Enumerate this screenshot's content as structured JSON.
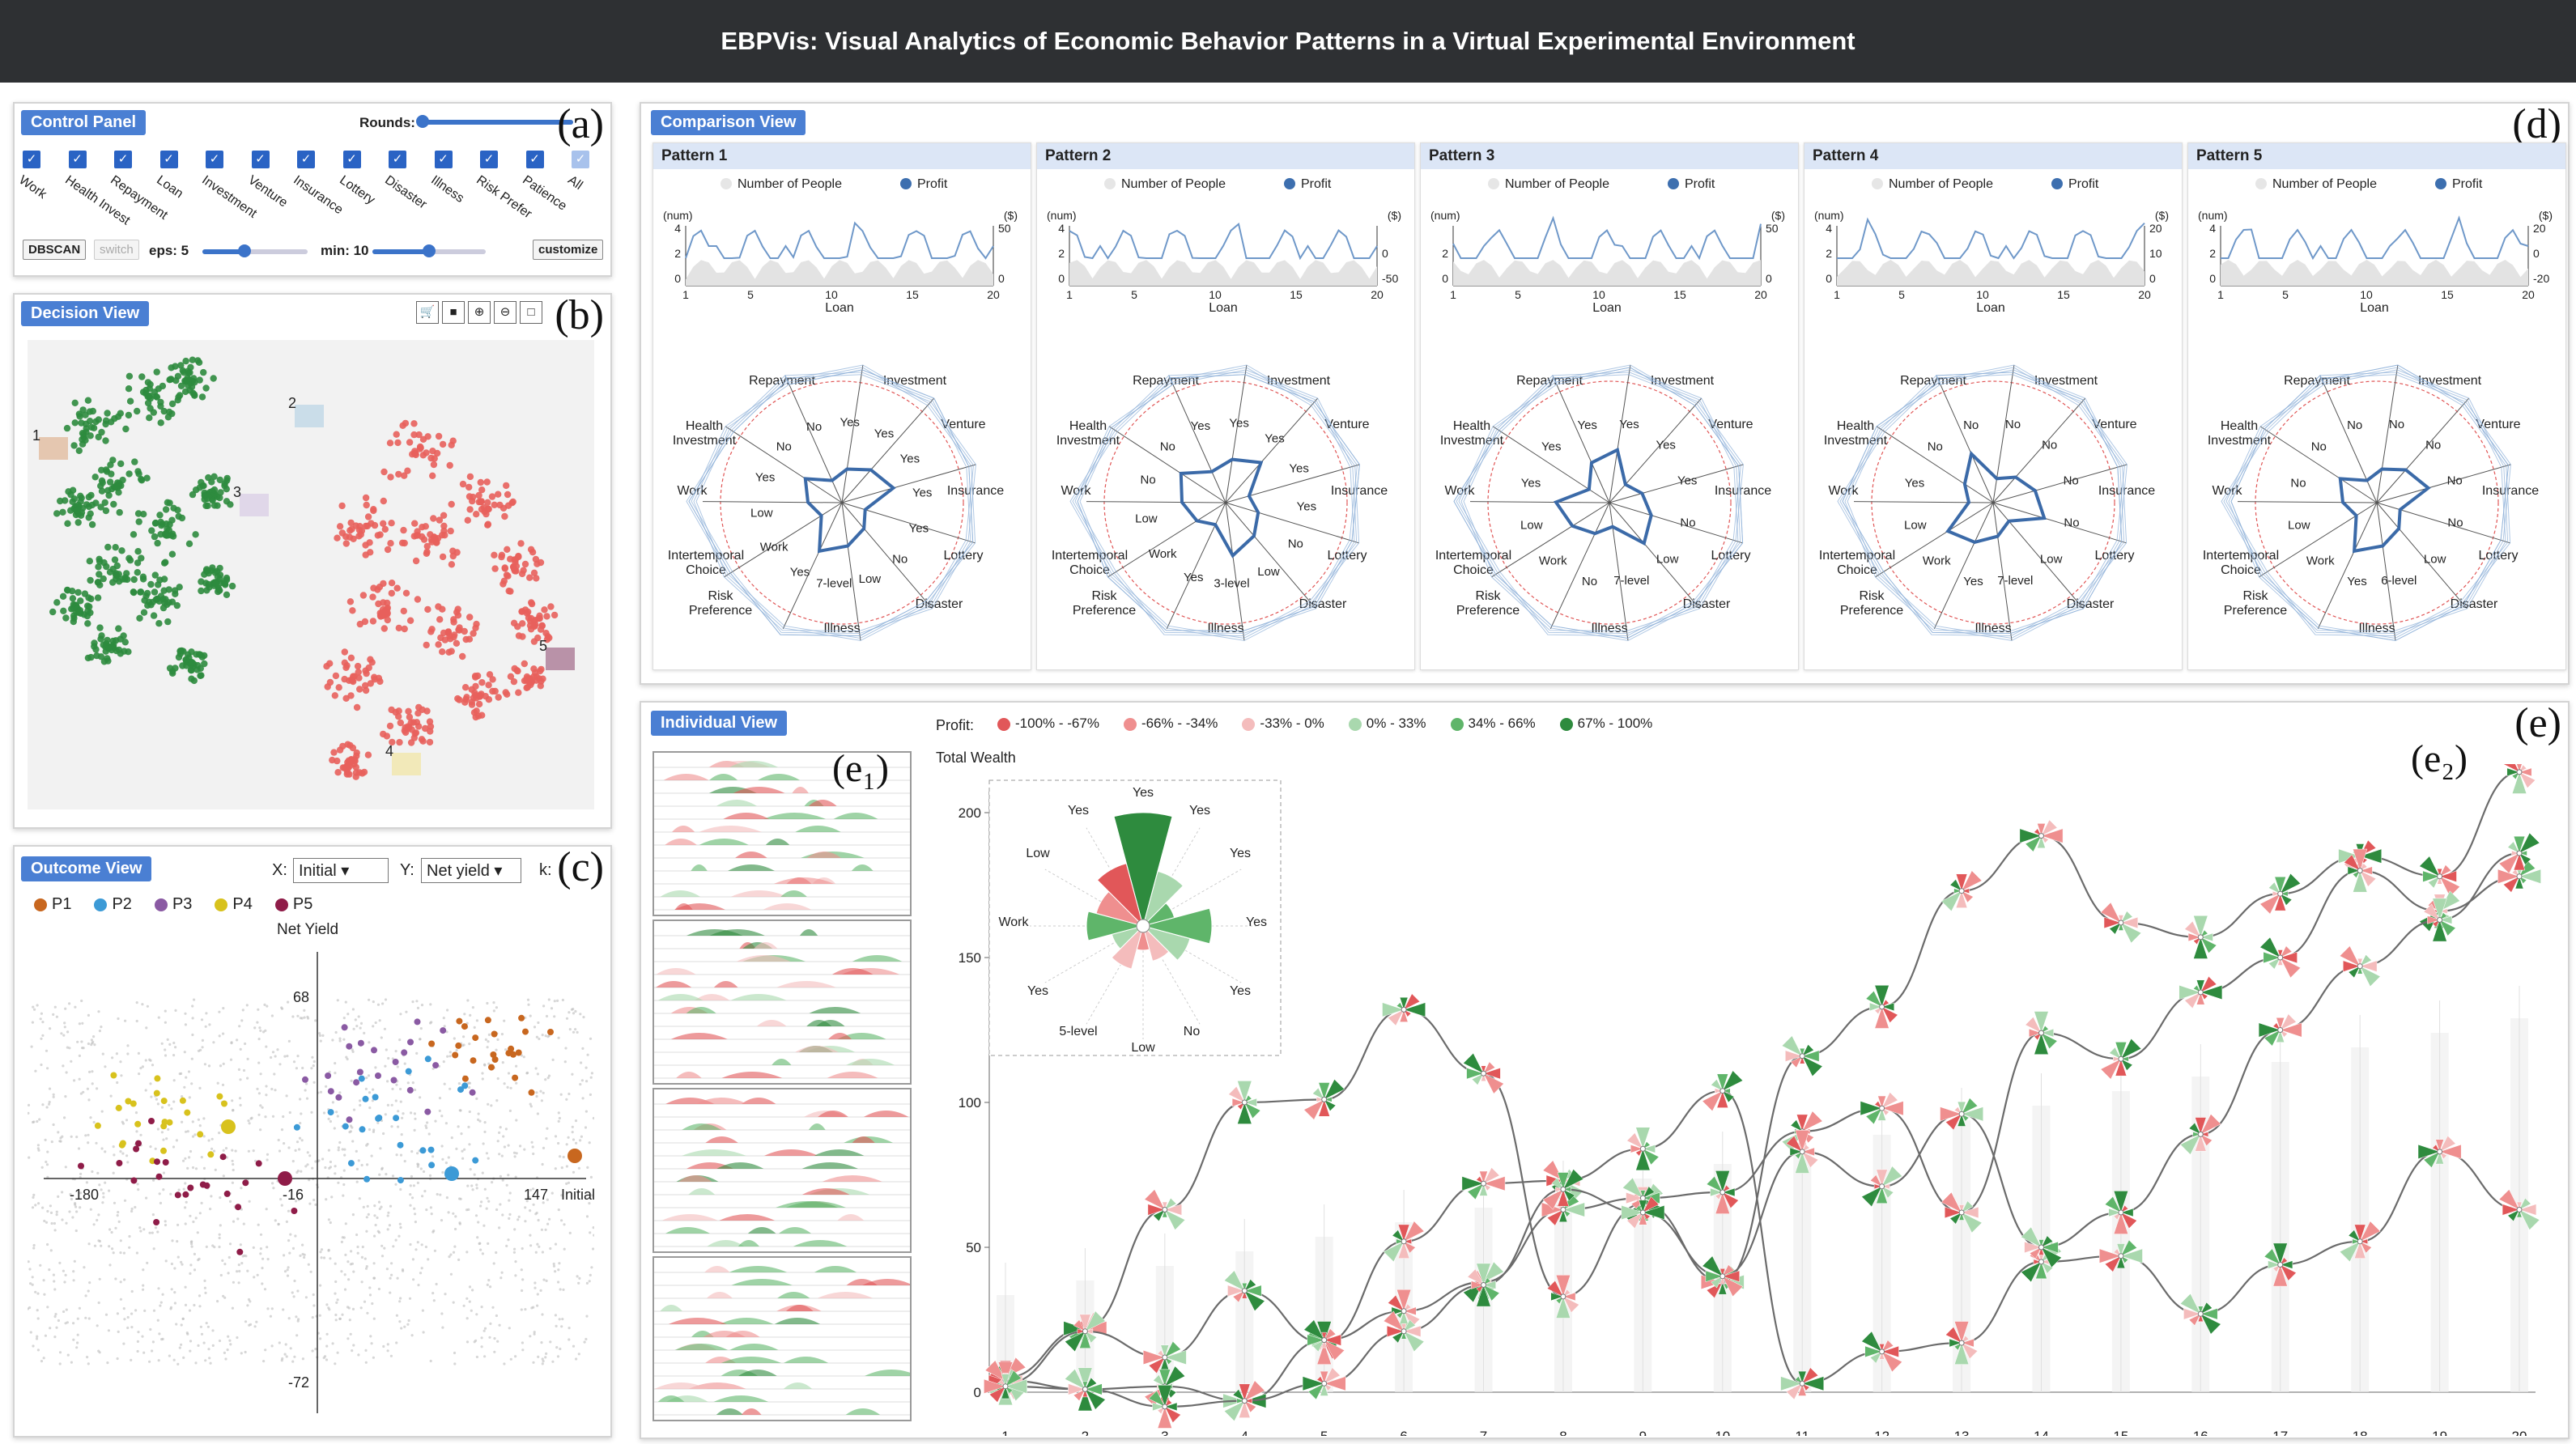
{
  "app": {
    "title": "EBPVis: Visual Analytics of Economic Behavior Patterns in a Virtual Experimental Environment"
  },
  "control_panel": {
    "tag": "Control Panel",
    "letter": "(a)",
    "rounds_label": "Rounds:",
    "checkboxes": [
      "Work",
      "Health Invest",
      "Repayment",
      "Loan",
      "Investment",
      "Venture",
      "Insurance",
      "Lottery",
      "Disaster",
      "Illness",
      "Risk Prefer",
      "Patience",
      "All"
    ],
    "dbscan_label": "DBSCAN",
    "switch_label": "switch",
    "eps_label": "eps: 5",
    "min_label": "min: 10",
    "customize_label": "customize",
    "eps_value": 0.4,
    "min_value": 0.5
  },
  "decision_view": {
    "tag": "Decision View",
    "letter": "(b)",
    "markers": [
      "1",
      "2",
      "3",
      "4",
      "5"
    ],
    "tool_icons": [
      "cart-icon",
      "filled-cart-icon",
      "zoom-in-icon",
      "zoom-out-icon",
      "select-box-icon"
    ],
    "colors": {
      "green": "#2e8b3e",
      "red": "#e8605c"
    }
  },
  "outcome_view": {
    "tag": "Outcome View",
    "letter": "(c)",
    "x_label": "X:",
    "x_value": "Initial",
    "y_label": "Y:",
    "y_value": "Net yield",
    "k_label": "k:",
    "legend": [
      {
        "name": "P1",
        "color": "#c8671f"
      },
      {
        "name": "P2",
        "color": "#3c9ad6"
      },
      {
        "name": "P3",
        "color": "#8a5aa3"
      },
      {
        "name": "P4",
        "color": "#d8c21d"
      },
      {
        "name": "P5",
        "color": "#8f1c48"
      }
    ],
    "axis_title": "Net Yield",
    "x_axis_title": "Initial",
    "ticks": {
      "y_top": "68",
      "y_bottom": "-72",
      "x_left": "-180",
      "x_mid": "-16",
      "x_right": "147"
    }
  },
  "comparison_view": {
    "tag": "Comparison View",
    "letter": "(d)",
    "legend_people": "Number of People",
    "legend_profit": "Profit",
    "axis_num": "(num)",
    "axis_dollar": "($)",
    "x_title": "Loan",
    "x_ticks": [
      "1",
      "5",
      "10",
      "15",
      "20"
    ],
    "radar_axes": [
      "Repayment",
      "Investment",
      "Venture",
      "Insurance",
      "Lottery",
      "Disaster",
      "Illness",
      "Risk Preference",
      "Intertemporal Choice",
      "Work",
      "Health Investment"
    ],
    "patterns": [
      {
        "title": "Pattern 1",
        "left_ticks": [
          "4",
          "2",
          "0"
        ],
        "right_ticks": [
          "50",
          "",
          "0"
        ],
        "inner": [
          "No",
          "No",
          "Yes",
          "Yes",
          "Yes",
          "Yes",
          "Yes",
          "No",
          "Low",
          "7-level",
          "Yes",
          "Work",
          "Low",
          "Yes"
        ]
      },
      {
        "title": "Pattern 2",
        "left_ticks": [
          "4",
          "2",
          "0"
        ],
        "right_ticks": [
          "",
          "0",
          "-50"
        ],
        "inner": [
          "No",
          "Yes",
          "Yes",
          "Yes",
          "Yes",
          "Yes",
          "No",
          "Low",
          "3-level",
          "Yes",
          "Work",
          "Low",
          "No"
        ]
      },
      {
        "title": "Pattern 3",
        "left_ticks": [
          "",
          "2",
          "0"
        ],
        "right_ticks": [
          "50",
          "",
          "0"
        ],
        "inner": [
          "Yes",
          "Yes",
          "Yes",
          "Yes",
          "Yes",
          "No",
          "Low",
          "7-level",
          "No",
          "Work",
          "Low",
          "Yes"
        ]
      },
      {
        "title": "Pattern 4",
        "left_ticks": [
          "4",
          "2",
          "0"
        ],
        "right_ticks": [
          "20",
          "10",
          "0"
        ],
        "inner": [
          "No",
          "No",
          "No",
          "No",
          "No",
          "No",
          "Low",
          "7-level",
          "Yes",
          "Work",
          "Low",
          "Yes"
        ]
      },
      {
        "title": "Pattern 5",
        "left_ticks": [
          "4",
          "2",
          "0"
        ],
        "right_ticks": [
          "20",
          "0",
          "-20"
        ],
        "inner": [
          "No",
          "No",
          "No",
          "No",
          "No",
          "No",
          "Low",
          "6-level",
          "Yes",
          "Work",
          "Low",
          "No"
        ]
      }
    ]
  },
  "individual_view": {
    "tag": "Individual View",
    "letter": "(e)",
    "sub1": "(e₁)",
    "sub2": "(e₂)",
    "profit_label": "Profit:",
    "profit_legend": [
      {
        "label": "-100% - -67%",
        "color": "#e15759"
      },
      {
        "label": "-66% - -34%",
        "color": "#ef8f8f"
      },
      {
        "label": "-33% - 0%",
        "color": "#f4bcbc"
      },
      {
        "label": "0% - 33%",
        "color": "#a9d8ae"
      },
      {
        "label": "34% - 66%",
        "color": "#5fb56a"
      },
      {
        "label": "67% - 100%",
        "color": "#2e8b3e"
      }
    ],
    "y_title": "Total Wealth",
    "y_ticks": [
      "200",
      "150",
      "100",
      "50",
      "0"
    ],
    "x_ticks": [
      "1",
      "2",
      "3",
      "4",
      "5",
      "6",
      "7",
      "8",
      "9",
      "10",
      "11",
      "12",
      "13",
      "14",
      "15",
      "16",
      "17",
      "18",
      "19",
      "20"
    ],
    "glyph_labels": [
      "Yes",
      "Yes",
      "Yes",
      "Yes",
      "Yes",
      "Yes",
      "No",
      "Low",
      "5-level",
      "Yes",
      "Work",
      "Low",
      "Yes"
    ]
  },
  "chart_data": {
    "type": "line",
    "xlabel": "",
    "ylabel": "Total Wealth",
    "ylim": [
      0,
      200
    ],
    "x": [
      1,
      2,
      3,
      4,
      5,
      6,
      7,
      8,
      9,
      10,
      11,
      12,
      13,
      14,
      15,
      16,
      17,
      18,
      19,
      20
    ],
    "series": [
      {
        "values": [
          5,
          22,
          63,
          100,
          101,
          132,
          110,
          33,
          65,
          38,
          116,
          133,
          173,
          192,
          162,
          157,
          172,
          185,
          178,
          214
        ]
      },
      {
        "values": [
          3,
          21,
          12,
          35,
          17,
          52,
          72,
          73,
          84,
          104,
          3,
          14,
          17,
          45,
          47,
          27,
          44,
          52,
          83,
          63
        ]
      },
      {
        "values": [
          4,
          1,
          2,
          -3,
          18,
          28,
          38,
          63,
          67,
          69,
          90,
          98,
          62,
          124,
          115,
          138,
          150,
          180,
          166,
          178
        ]
      },
      {
        "values": [
          2,
          1,
          -5,
          -3,
          3,
          21,
          37,
          70,
          62,
          40,
          83,
          71,
          96,
          50,
          62,
          89,
          125,
          147,
          163,
          186
        ]
      }
    ]
  }
}
